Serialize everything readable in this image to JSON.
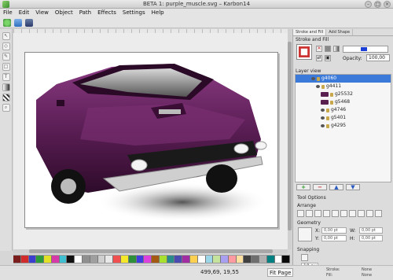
{
  "window": {
    "title": "BETA 1: purple_muscle.svg – Karbon14"
  },
  "menu": {
    "items": [
      "File",
      "Edit",
      "View",
      "Object",
      "Path",
      "Effects",
      "Settings",
      "Help"
    ]
  },
  "docker": {
    "tabs": [
      "Stroke and Fill",
      "Add Shape"
    ],
    "stroke_fill": {
      "title": "Stroke and Fill",
      "opacity_label": "Opacity:",
      "opacity_value": "100,00"
    },
    "layer_view": {
      "title": "Layer view",
      "layers": [
        "g4060",
        "g4411",
        "g25532",
        "g5468",
        "g4746",
        "g5401",
        "g4295"
      ]
    },
    "tool_options": {
      "title": "Tool Options",
      "arrange_label": "Arrange",
      "geometry_label": "Geometry",
      "x_label": "X:",
      "y_label": "Y:",
      "w_label": "W:",
      "h_label": "H:",
      "x_value": "0,00 pt",
      "y_value": "0,00 pt",
      "w_value": "0,00 pt",
      "h_value": "0,00 pt",
      "snapping_label": "Snapping",
      "snap_value": "10 px"
    }
  },
  "status": {
    "coords": "499,69, 19,55",
    "zoom": "Fit Page",
    "stroke_label": "Stroke:",
    "fill_label": "Fill:",
    "stroke_value": "None",
    "fill_value": "None"
  },
  "colors": {
    "accent": "#3b7ad9",
    "car_body": "#5b1e55",
    "palette": [
      "#7a1d1d",
      "#d12b2b",
      "#3a3fcf",
      "#2b9b3b",
      "#e3e028",
      "#d53aa8",
      "#3fbfd0",
      "#111111",
      "#ffffff",
      "#8f8f8f",
      "#9f9f9f",
      "#cfcfcf",
      "#e8e8e8",
      "#f05050",
      "#f5e82a",
      "#2e8f3a",
      "#3f3fdd",
      "#de40de",
      "#a55a14",
      "#a8e030",
      "#2a8b8b",
      "#4a4ab0",
      "#a22da2",
      "#ffd050",
      "#ffffff",
      "#9ad6e8",
      "#c5e39d",
      "#a89ff0",
      "#ff9ba0",
      "#ffe0a0",
      "#404040",
      "#6e6e6e",
      "#b0b0b0",
      "#008080",
      "#ffffff",
      "#0a0a0a"
    ]
  }
}
